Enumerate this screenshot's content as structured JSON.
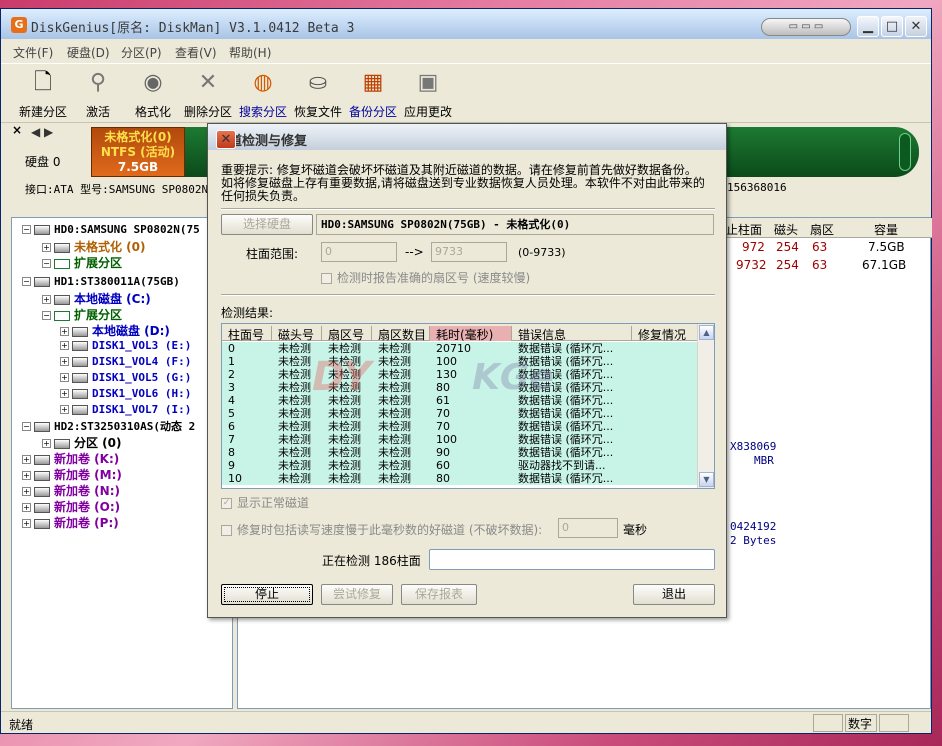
{
  "window": {
    "title": "DiskGenius[原名: DiskMan] V3.1.0412 Beta 3",
    "app_icon": "G"
  },
  "menu": [
    "文件(F)",
    "硬盘(D)",
    "分区(P)",
    "查看(V)",
    "帮助(H)"
  ],
  "toolbar": [
    {
      "label": "新建分区",
      "icon": "new-partition-icon"
    },
    {
      "label": "激活",
      "icon": "activate-icon"
    },
    {
      "label": "格式化",
      "icon": "format-icon"
    },
    {
      "label": "删除分区",
      "icon": "delete-partition-icon"
    },
    {
      "label": "搜索分区",
      "icon": "search-partition-icon"
    },
    {
      "label": "恢复文件",
      "icon": "recover-files-icon"
    },
    {
      "label": "备份分区",
      "icon": "backup-partition-icon"
    },
    {
      "label": "应用更改",
      "icon": "apply-changes-icon"
    }
  ],
  "diskbar": {
    "disk_label": "硬盘 0",
    "partition": {
      "line1": "未格式化(0)",
      "line2": "NTFS (活动)",
      "line3": "7.5GB"
    },
    "iface_info": "接口:ATA  型号:SAMSUNG SP0802N",
    "iface_extra": "156368016"
  },
  "tree": [
    {
      "text": "HD0:SAMSUNG SP0802N(75",
      "kind": "hdd"
    },
    {
      "text": "未格式化 (0)",
      "kind": "part",
      "color": "#b06000"
    },
    {
      "text": "扩展分区",
      "kind": "ext",
      "color": "#006000"
    },
    {
      "text": "HD1:ST380011A(75GB)",
      "kind": "hdd"
    },
    {
      "text": "本地磁盘 (C:)",
      "kind": "part",
      "color": "#0000c0"
    },
    {
      "text": "扩展分区",
      "kind": "ext",
      "color": "#006000"
    },
    {
      "text": "本地磁盘 (D:)",
      "kind": "part",
      "color": "#0000c0"
    },
    {
      "text": "DISK1_VOL3 (E:)",
      "kind": "part",
      "color": "#0000c0"
    },
    {
      "text": "DISK1_VOL4 (F:)",
      "kind": "part",
      "color": "#0000c0"
    },
    {
      "text": "DISK1_VOL5 (G:)",
      "kind": "part",
      "color": "#0000c0"
    },
    {
      "text": "DISK1_VOL6 (H:)",
      "kind": "part",
      "color": "#0000c0"
    },
    {
      "text": "DISK1_VOL7 (I:)",
      "kind": "part",
      "color": "#0000c0"
    },
    {
      "text": "HD2:ST3250310AS(动态 2",
      "kind": "hdd"
    },
    {
      "text": "分区 (0)",
      "kind": "part",
      "color": "#000000"
    },
    {
      "text": "新加卷 (K:)",
      "kind": "vol",
      "color": "#8000a0"
    },
    {
      "text": "新加卷 (M:)",
      "kind": "vol",
      "color": "#8000a0"
    },
    {
      "text": "新加卷 (N:)",
      "kind": "vol",
      "color": "#8000a0"
    },
    {
      "text": "新加卷 (O:)",
      "kind": "vol",
      "color": "#8000a0"
    },
    {
      "text": "新加卷 (P:)",
      "kind": "vol",
      "color": "#8000a0"
    }
  ],
  "partition_table": {
    "headers": [
      "止柱面",
      "磁头",
      "扇区",
      "容量"
    ],
    "rows": [
      [
        "972",
        "254",
        "63",
        "7.5GB"
      ],
      [
        "9732",
        "254",
        "63",
        "67.1GB"
      ]
    ]
  },
  "right_extra": [
    "X838069",
    "MBR",
    "0424192",
    "2 Bytes"
  ],
  "status": {
    "text": "就绪",
    "num": "数字"
  },
  "dialog": {
    "title": "坏道检测与修复",
    "notice": [
      "重要提示: 修复坏磁道会破坏坏磁道及其附近磁道的数据。请在修复前首先做好数据备份。",
      "如将修复磁盘上存有重要数据,请将磁盘送到专业数据恢复人员处理。本软件不对由此带来的",
      "任何损失负责。"
    ],
    "select_disk": "选择硬盘",
    "disk_name": "HD0:SAMSUNG SP0802N(75GB) - 未格式化(0)",
    "cyl_label": "柱面范围:",
    "cyl_from": "0",
    "cyl_arrow": "-->",
    "cyl_to": "9733",
    "cyl_hint": "(0-9733)",
    "report_sector": "检测时报告准确的扇区号 (速度较慢)",
    "results_label": "检测结果:",
    "columns": [
      "柱面号",
      "磁头号",
      "扇区号",
      "扇区数目",
      "耗时(毫秒)",
      "错误信息",
      "修复情况"
    ],
    "rows": [
      [
        "0",
        "未检测",
        "未检测",
        "未检测",
        "20710",
        "数据错误 (循环冗..."
      ],
      [
        "1",
        "未检测",
        "未检测",
        "未检测",
        "100",
        "数据错误 (循环冗..."
      ],
      [
        "2",
        "未检测",
        "未检测",
        "未检测",
        "130",
        "数据错误 (循环冗..."
      ],
      [
        "3",
        "未检测",
        "未检测",
        "未检测",
        "80",
        "数据错误 (循环冗..."
      ],
      [
        "4",
        "未检测",
        "未检测",
        "未检测",
        "61",
        "数据错误 (循环冗..."
      ],
      [
        "5",
        "未检测",
        "未检测",
        "未检测",
        "70",
        "数据错误 (循环冗..."
      ],
      [
        "6",
        "未检测",
        "未检测",
        "未检测",
        "70",
        "数据错误 (循环冗..."
      ],
      [
        "7",
        "未检测",
        "未检测",
        "未检测",
        "100",
        "数据错误 (循环冗..."
      ],
      [
        "8",
        "未检测",
        "未检测",
        "未检测",
        "90",
        "数据错误 (循环冗..."
      ],
      [
        "9",
        "未检测",
        "未检测",
        "未检测",
        "60",
        "驱动器找不到请..."
      ],
      [
        "10",
        "未检测",
        "未检测",
        "未检测",
        "80",
        "数据错误 (循环冗..."
      ]
    ],
    "show_normal": "显示正常磁道",
    "repair_slow": "修复时包括读写速度慢于此毫秒数的好磁道 (不破坏数据):",
    "slow_ms": "0",
    "ms_unit": "毫秒",
    "detecting": "正在检测 186柱面",
    "stop": "停止",
    "try_repair": "尝试修复",
    "save_report": "保存报表",
    "exit": "退出",
    "watermark1": "DY",
    "watermark2": "KGe"
  }
}
